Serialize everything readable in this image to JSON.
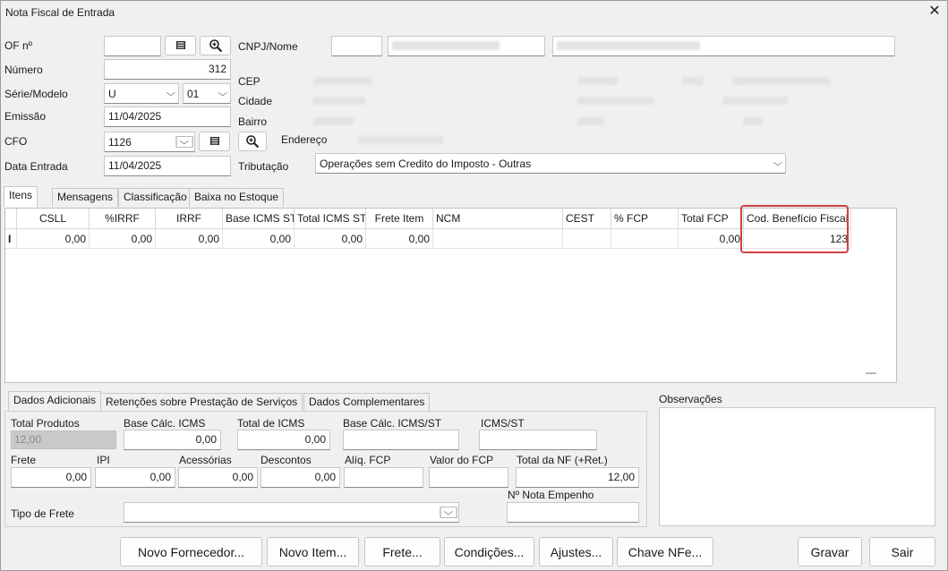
{
  "window": {
    "title": "Nota Fiscal de Entrada",
    "close_glyph": "✕"
  },
  "form": {
    "of_label": "OF nº",
    "of_value": "",
    "numero_label": "Número",
    "numero_value": "312",
    "serie_label": "Série/Modelo",
    "serie_value": "U",
    "modelo_value": "01",
    "emissao_label": "Emissão",
    "emissao_value": "11/04/2025",
    "cfo_label": "CFO",
    "cfo_value": "1126",
    "data_entrada_label": "Data Entrada",
    "data_entrada_value": "11/04/2025",
    "cnpj_label": "CNPJ/Nome",
    "cep_label": "CEP",
    "cidade_label": "Cidade",
    "bairro_label": "Bairro",
    "endereco_label": "Endereço",
    "tributacao_label": "Tributação",
    "tributacao_value": "Operações sem Credito do Imposto - Outras"
  },
  "tabs": [
    "Itens",
    "Mensagens",
    "Classificação",
    "Baixa no Estoque"
  ],
  "items_grid": {
    "columns": [
      "CSLL",
      "%IRRF",
      "IRRF",
      "Base ICMS ST",
      "Total ICMS ST",
      "Frete Item",
      "NCM",
      "CEST",
      "% FCP",
      "Total FCP",
      "Cod. Benefício Fiscal"
    ],
    "row_marker": "I",
    "rows": [
      [
        "0,00",
        "0,00",
        "0,00",
        "0,00",
        "0,00",
        "0,00",
        "",
        "",
        "",
        "0,00",
        "123"
      ]
    ],
    "footer_glyph": "—"
  },
  "bottom_tabs": [
    "Dados Adicionais",
    "Retenções sobre Prestação de Serviços",
    "Dados Complementares"
  ],
  "totals": {
    "total_produtos_label": "Total Produtos",
    "total_produtos_value": "12,00",
    "base_icms_label": "Base Cálc. ICMS",
    "base_icms_value": "0,00",
    "total_icms_label": "Total de ICMS",
    "total_icms_value": "0,00",
    "base_icms_st_label": "Base Cálc. ICMS/ST",
    "base_icms_st_value": "",
    "icms_st_label": "ICMS/ST",
    "icms_st_value": "",
    "frete_label": "Frete",
    "frete_value": "0,00",
    "ipi_label": "IPI",
    "ipi_value": "0,00",
    "acessorias_label": "Acessórias",
    "acessorias_value": "0,00",
    "descontos_label": "Descontos",
    "descontos_value": "0,00",
    "aliq_fcp_label": "Alíq. FCP",
    "aliq_fcp_value": "",
    "valor_fcp_label": "Valor do FCP",
    "valor_fcp_value": "",
    "total_nf_label": "Total da NF (+Ret.)",
    "total_nf_value": "12,00",
    "tipo_frete_label": "Tipo de Frete",
    "tipo_frete_value": "",
    "nota_empenho_label": "Nº Nota Empenho",
    "nota_empenho_value": ""
  },
  "observacoes_label": "Observações",
  "buttons": {
    "novo_fornecedor": "Novo Fornecedor...",
    "novo_item": "Novo Item...",
    "frete": "Frete...",
    "condicoes": "Condições...",
    "ajustes": "Ajustes...",
    "chave_nfe": "Chave NFe...",
    "gravar": "Gravar",
    "sair": "Sair"
  },
  "colors": {
    "highlight": "#d04040",
    "window_bg": "#f0f0f0"
  },
  "icons": [
    "list-icon",
    "magnifier-icon",
    "chevron-down-icon",
    "close-icon"
  ]
}
